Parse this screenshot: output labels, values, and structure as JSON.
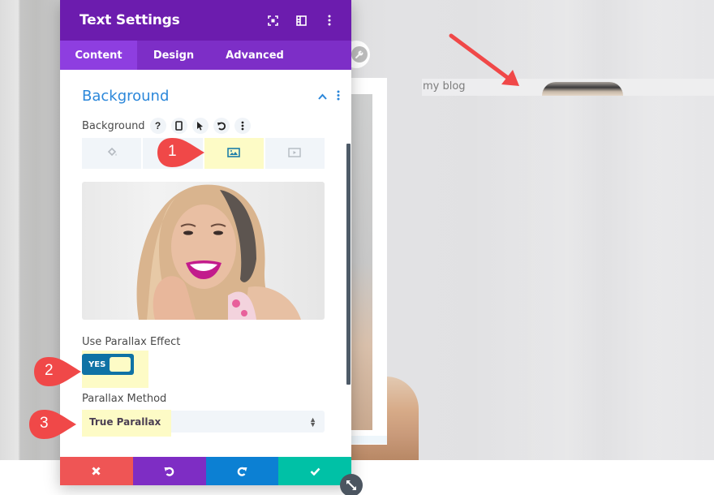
{
  "panel": {
    "title": "Text Settings",
    "header_icons": [
      "fullscreen-icon",
      "sidebar-layout-icon",
      "kebab-menu-icon"
    ],
    "tabs": [
      {
        "label": "Content",
        "active": true
      },
      {
        "label": "Design",
        "active": false
      },
      {
        "label": "Advanced",
        "active": false
      }
    ],
    "section": {
      "title": "Background",
      "expanded": true
    },
    "background_field": {
      "label": "Background",
      "option_icons": [
        "help-icon",
        "mobile-icon",
        "hover-cursor-icon",
        "reset-icon",
        "kebab-menu-icon"
      ],
      "type_tabs": [
        {
          "icon": "color-fill-icon",
          "selected": false
        },
        {
          "icon": "gradient-icon",
          "selected": false
        },
        {
          "icon": "image-icon",
          "selected": true
        },
        {
          "icon": "video-icon",
          "selected": false
        }
      ]
    },
    "parallax": {
      "label": "Use Parallax Effect",
      "toggle_label": "YES",
      "enabled": true
    },
    "parallax_method": {
      "label": "Parallax Method",
      "value": "True Parallax"
    },
    "footer": {
      "buttons": [
        {
          "name": "discard",
          "icon": "✖",
          "color": "#ef5555"
        },
        {
          "name": "undo",
          "icon": "↺",
          "color": "#7e2dc4"
        },
        {
          "name": "redo",
          "icon": "↻",
          "color": "#0c80d3"
        },
        {
          "name": "save",
          "icon": "✔",
          "color": "#00c1a6"
        }
      ]
    }
  },
  "callouts": [
    {
      "number": "1"
    },
    {
      "number": "2"
    },
    {
      "number": "3"
    }
  ],
  "preview": {
    "blog_text": "my blog"
  },
  "colors": {
    "header_purple": "#6c1cae",
    "tab_purple": "#7d2ec7",
    "accent_blue": "#2b87da",
    "highlight_yellow": "#fdfbc6",
    "callout_red": "#f04848"
  }
}
